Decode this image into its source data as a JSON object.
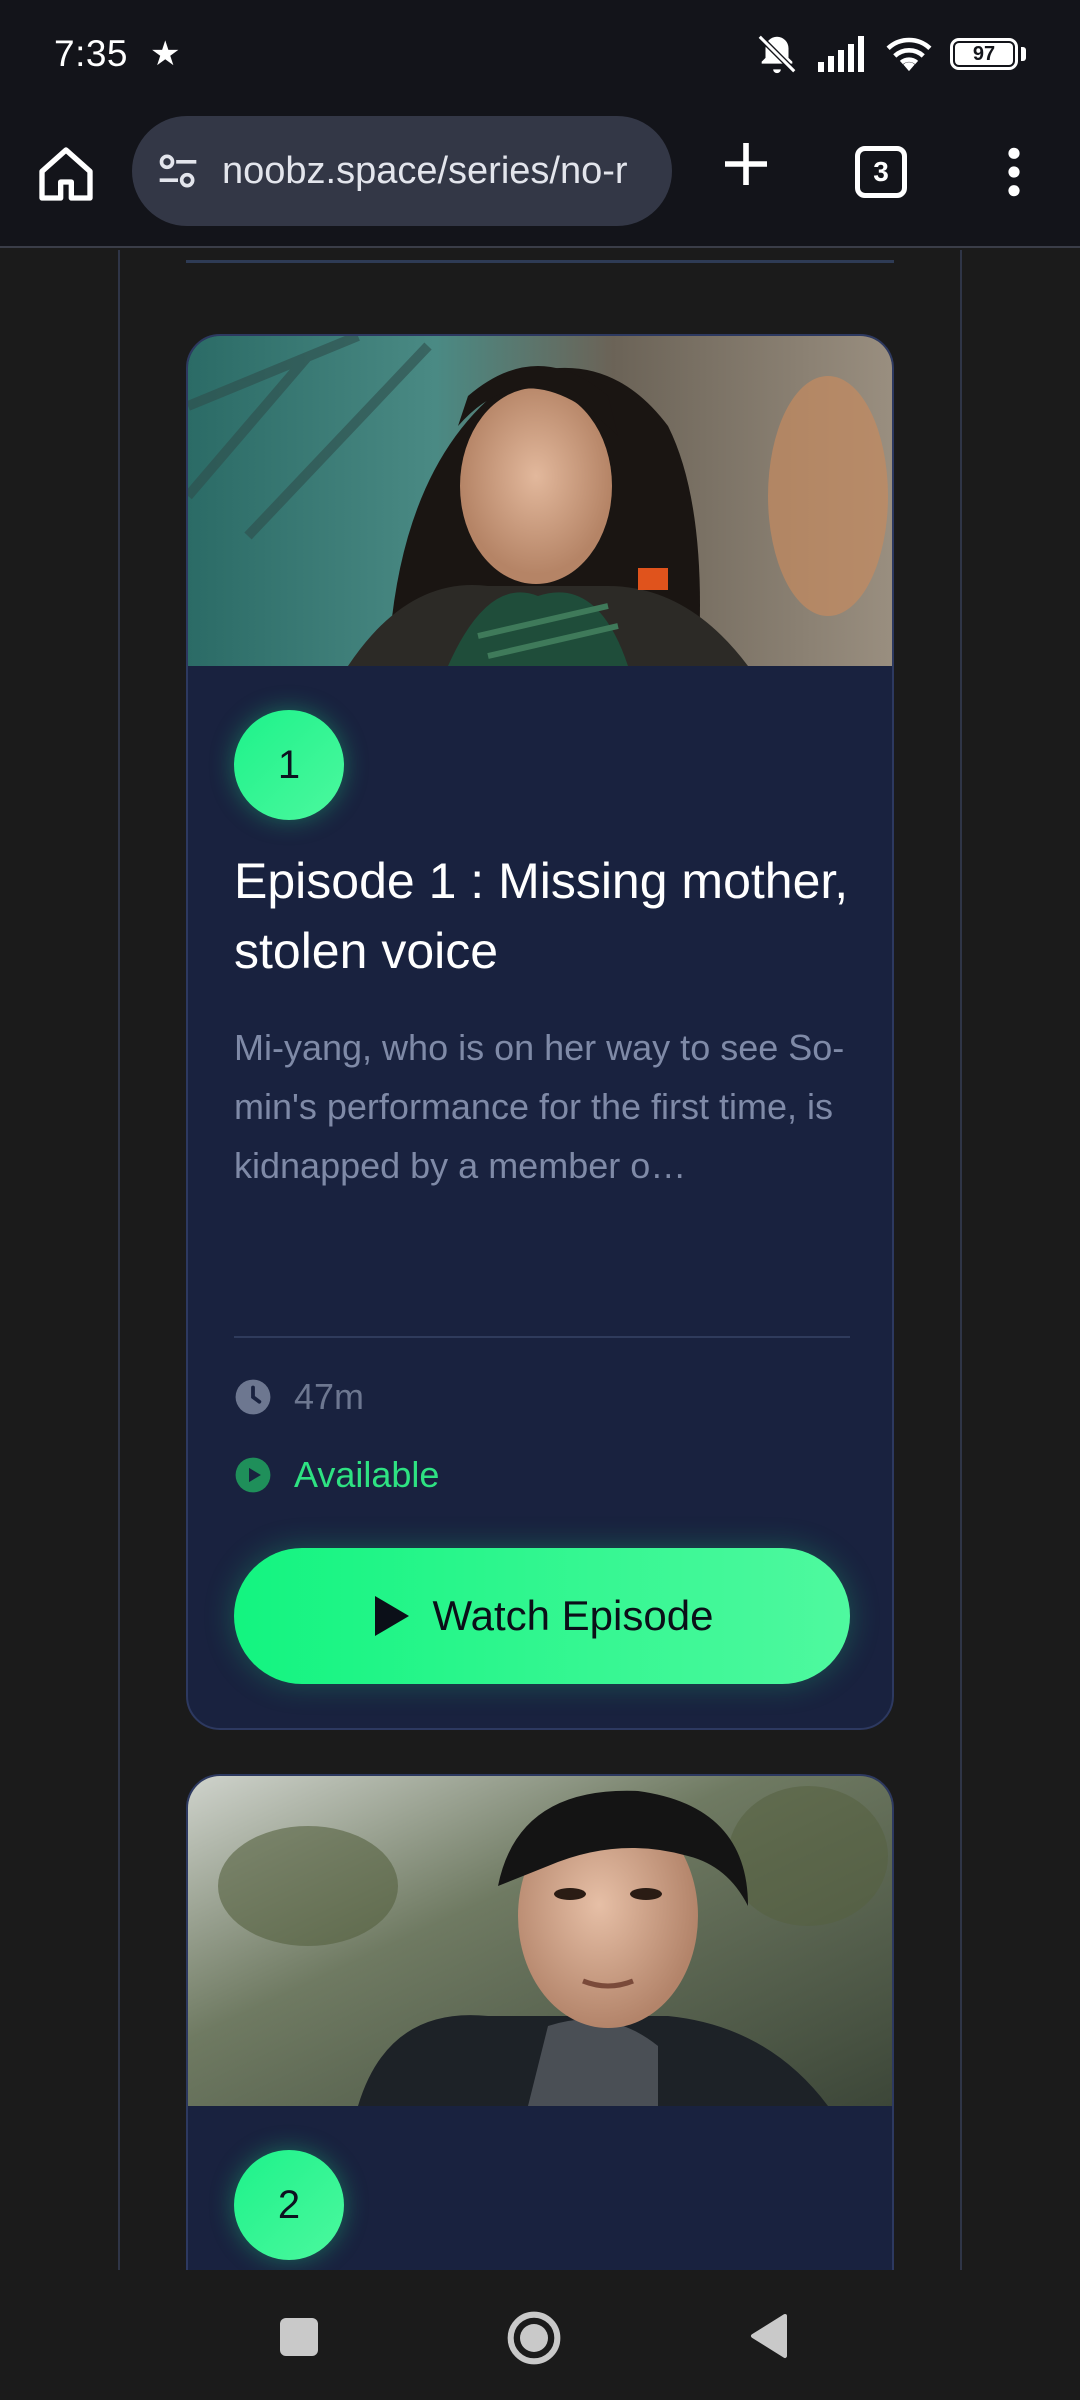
{
  "status_bar": {
    "time": "7:35",
    "star_icon": "star-icon",
    "icons": [
      "mute-icon",
      "signal-icon",
      "wifi-icon",
      "battery-icon"
    ],
    "battery_level": "97"
  },
  "browser": {
    "url": "noobz.space/series/no-r",
    "tab_count": "3",
    "icons": [
      "home-icon",
      "site-settings-icon",
      "new-tab-icon",
      "tab-switcher-icon",
      "overflow-menu-icon"
    ]
  },
  "episodes": [
    {
      "number": "1",
      "title": "Episode 1 : Missing mother, stolen voice",
      "description": "Mi-yang, who is on her way to see So-min's performance for the first time, is kidnapped by a member o…",
      "duration": "47m",
      "status": "Available",
      "button_label": "Watch Episode"
    },
    {
      "number": "2"
    }
  ],
  "colors": {
    "card_bg": "#19223f",
    "accent_green": "#1df28a",
    "status_green": "#2ee282",
    "muted_text": "#7f8aa7"
  },
  "navigation_bar": {
    "icons": [
      "recents-square-icon",
      "home-circle-icon",
      "back-triangle-icon"
    ]
  }
}
